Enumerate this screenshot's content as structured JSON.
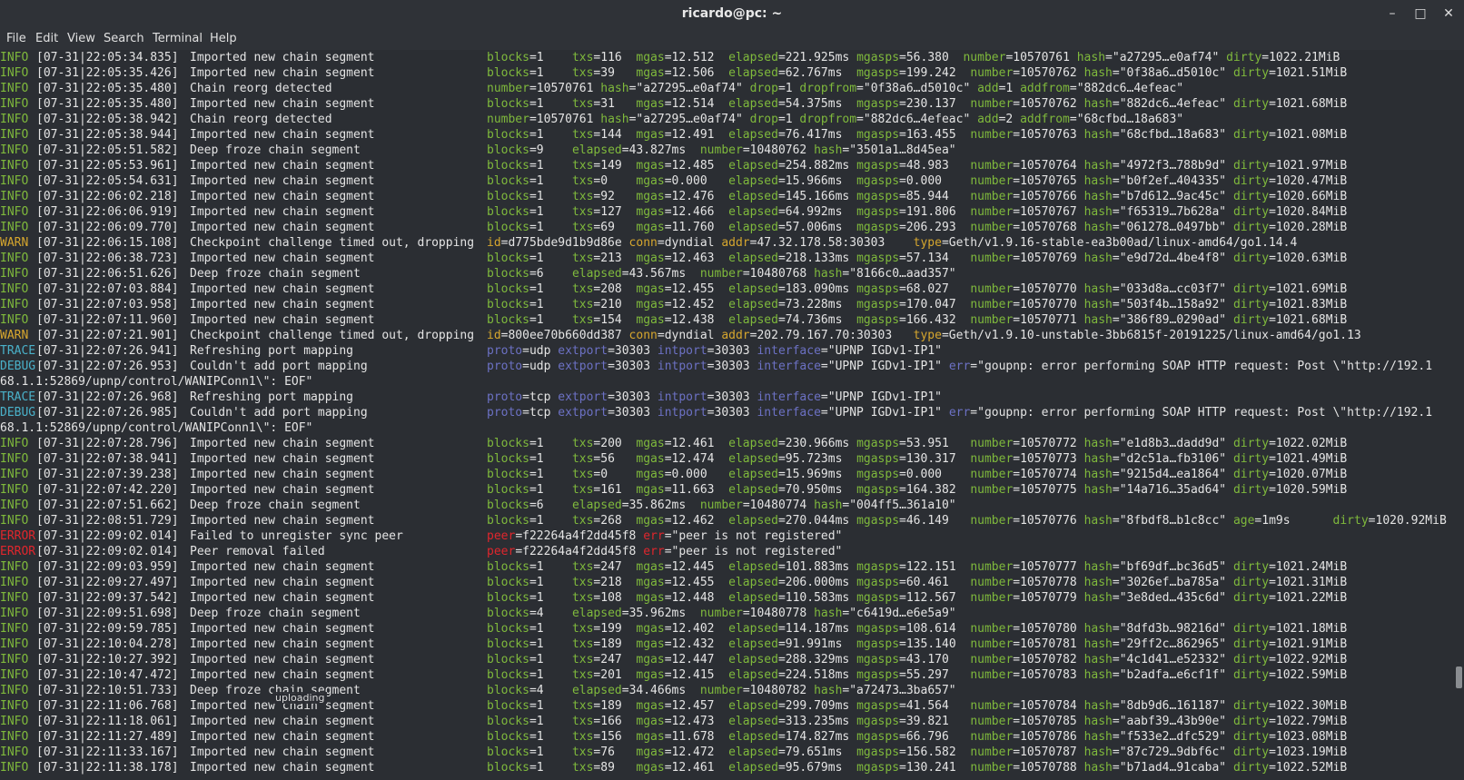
{
  "window": {
    "title": "ricardo@pc: ~"
  },
  "menu": [
    "File",
    "Edit",
    "View",
    "Search",
    "Terminal",
    "Help"
  ],
  "tooltip": "uploading",
  "scroll": {
    "position_fraction": 0.87
  },
  "colors": {
    "info": "#7fb93c",
    "warn": "#d6a62e",
    "error": "#e0262d",
    "trace_debug": "#4ab1c9",
    "key_trace_debug": "#6c71c4",
    "background": "#2b2e33"
  },
  "lines": [
    {
      "level": "INFO",
      "ts": "[07-31|22:05:34.835]",
      "msg": "Imported new chain segment",
      "fields": "blocks=1    txs=116  mgas=12.512  elapsed=221.925ms mgasps=56.380  number=10570761 hash=\"a27295…e0af74\" dirty=1022.21MiB"
    },
    {
      "level": "INFO",
      "ts": "[07-31|22:05:35.426]",
      "msg": "Imported new chain segment",
      "fields": "blocks=1    txs=39   mgas=12.506  elapsed=62.767ms  mgasps=199.242  number=10570762 hash=\"0f38a6…d5010c\" dirty=1021.51MiB"
    },
    {
      "level": "INFO",
      "ts": "[07-31|22:05:35.480]",
      "msg": "Chain reorg detected",
      "fields": "number=10570761 hash=\"a27295…e0af74\" drop=1 dropfrom=\"0f38a6…d5010c\" add=1 addfrom=\"882dc6…4efeac\""
    },
    {
      "level": "INFO",
      "ts": "[07-31|22:05:35.480]",
      "msg": "Imported new chain segment",
      "fields": "blocks=1    txs=31   mgas=12.514  elapsed=54.375ms  mgasps=230.137  number=10570762 hash=\"882dc6…4efeac\" dirty=1021.68MiB"
    },
    {
      "level": "INFO",
      "ts": "[07-31|22:05:38.942]",
      "msg": "Chain reorg detected",
      "fields": "number=10570761 hash=\"a27295…e0af74\" drop=1 dropfrom=\"882dc6…4efeac\" add=2 addfrom=\"68cfbd…18a683\""
    },
    {
      "level": "INFO",
      "ts": "[07-31|22:05:38.944]",
      "msg": "Imported new chain segment",
      "fields": "blocks=1    txs=144  mgas=12.491  elapsed=76.417ms  mgasps=163.455  number=10570763 hash=\"68cfbd…18a683\" dirty=1021.08MiB"
    },
    {
      "level": "INFO",
      "ts": "[07-31|22:05:51.582]",
      "msg": "Deep froze chain segment",
      "fields": "blocks=9    elapsed=43.827ms  number=10480762 hash=\"3501a1…8d45ea\""
    },
    {
      "level": "INFO",
      "ts": "[07-31|22:05:53.961]",
      "msg": "Imported new chain segment",
      "fields": "blocks=1    txs=149  mgas=12.485  elapsed=254.882ms mgasps=48.983   number=10570764 hash=\"4972f3…788b9d\" dirty=1021.97MiB"
    },
    {
      "level": "INFO",
      "ts": "[07-31|22:05:54.631]",
      "msg": "Imported new chain segment",
      "fields": "blocks=1    txs=0    mgas=0.000   elapsed=15.966ms  mgasps=0.000    number=10570765 hash=\"b0f2ef…404335\" dirty=1020.47MiB"
    },
    {
      "level": "INFO",
      "ts": "[07-31|22:06:02.218]",
      "msg": "Imported new chain segment",
      "fields": "blocks=1    txs=92   mgas=12.476  elapsed=145.166ms mgasps=85.944   number=10570766 hash=\"b7d612…9ac45c\" dirty=1020.66MiB"
    },
    {
      "level": "INFO",
      "ts": "[07-31|22:06:06.919]",
      "msg": "Imported new chain segment",
      "fields": "blocks=1    txs=127  mgas=12.466  elapsed=64.992ms  mgasps=191.806  number=10570767 hash=\"f65319…7b628a\" dirty=1020.84MiB"
    },
    {
      "level": "INFO",
      "ts": "[07-31|22:06:09.770]",
      "msg": "Imported new chain segment",
      "fields": "blocks=1    txs=69   mgas=11.760  elapsed=57.006ms  mgasps=206.293  number=10570768 hash=\"061278…0497bb\" dirty=1020.28MiB"
    },
    {
      "level": "WARN",
      "ts": "[07-31|22:06:15.108]",
      "msg": "Checkpoint challenge timed out, dropping",
      "fields": "id=d775bde9d1b9d86e conn=dyndial addr=47.32.178.58:30303    type=Geth/v1.9.16-stable-ea3b00ad/linux-amd64/go1.14.4"
    },
    {
      "level": "INFO",
      "ts": "[07-31|22:06:38.723]",
      "msg": "Imported new chain segment",
      "fields": "blocks=1    txs=213  mgas=12.463  elapsed=218.133ms mgasps=57.134   number=10570769 hash=\"e9d72d…4be4f8\" dirty=1020.63MiB"
    },
    {
      "level": "INFO",
      "ts": "[07-31|22:06:51.626]",
      "msg": "Deep froze chain segment",
      "fields": "blocks=6    elapsed=43.567ms  number=10480768 hash=\"8166c0…aad357\""
    },
    {
      "level": "INFO",
      "ts": "[07-31|22:07:03.884]",
      "msg": "Imported new chain segment",
      "fields": "blocks=1    txs=208  mgas=12.455  elapsed=183.090ms mgasps=68.027   number=10570770 hash=\"033d8a…cc03f7\" dirty=1021.69MiB"
    },
    {
      "level": "INFO",
      "ts": "[07-31|22:07:03.958]",
      "msg": "Imported new chain segment",
      "fields": "blocks=1    txs=210  mgas=12.452  elapsed=73.228ms  mgasps=170.047  number=10570770 hash=\"503f4b…158a92\" dirty=1021.83MiB"
    },
    {
      "level": "INFO",
      "ts": "[07-31|22:07:11.960]",
      "msg": "Imported new chain segment",
      "fields": "blocks=1    txs=154  mgas=12.438  elapsed=74.736ms  mgasps=166.432  number=10570771 hash=\"386f89…0290ad\" dirty=1021.68MiB"
    },
    {
      "level": "WARN",
      "ts": "[07-31|22:07:21.901]",
      "msg": "Checkpoint challenge timed out, dropping",
      "fields": "id=800ee70b660dd387 conn=dyndial addr=202.79.167.70:30303   type=Geth/v1.9.10-unstable-3bb6815f-20191225/linux-amd64/go1.13"
    },
    {
      "level": "TRACE",
      "ts": "[07-31|22:07:26.941]",
      "msg": "Refreshing port mapping",
      "fields": "proto=udp extport=30303 intport=30303 interface=\"UPNP IGDv1-IP1\""
    },
    {
      "level": "DEBUG",
      "ts": "[07-31|22:07:26.953]",
      "msg": "Couldn't add port mapping",
      "fields": "proto=udp extport=30303 intport=30303 interface=\"UPNP IGDv1-IP1\" err=\"goupnp: error performing SOAP HTTP request: Post \\\"http://192.1"
    },
    {
      "level": "",
      "ts": "",
      "msg": "",
      "fields": "",
      "wrap": "68.1.1:52869/upnp/control/WANIPConn1\\\": EOF\""
    },
    {
      "level": "TRACE",
      "ts": "[07-31|22:07:26.968]",
      "msg": "Refreshing port mapping",
      "fields": "proto=tcp extport=30303 intport=30303 interface=\"UPNP IGDv1-IP1\""
    },
    {
      "level": "DEBUG",
      "ts": "[07-31|22:07:26.985]",
      "msg": "Couldn't add port mapping",
      "fields": "proto=tcp extport=30303 intport=30303 interface=\"UPNP IGDv1-IP1\" err=\"goupnp: error performing SOAP HTTP request: Post \\\"http://192.1"
    },
    {
      "level": "",
      "ts": "",
      "msg": "",
      "fields": "",
      "wrap": "68.1.1:52869/upnp/control/WANIPConn1\\\": EOF\""
    },
    {
      "level": "INFO",
      "ts": "[07-31|22:07:28.796]",
      "msg": "Imported new chain segment",
      "fields": "blocks=1    txs=200  mgas=12.461  elapsed=230.966ms mgasps=53.951   number=10570772 hash=\"e1d8b3…dadd9d\" dirty=1022.02MiB"
    },
    {
      "level": "INFO",
      "ts": "[07-31|22:07:38.941]",
      "msg": "Imported new chain segment",
      "fields": "blocks=1    txs=56   mgas=12.474  elapsed=95.723ms  mgasps=130.317  number=10570773 hash=\"d2c51a…fb3106\" dirty=1021.49MiB"
    },
    {
      "level": "INFO",
      "ts": "[07-31|22:07:39.238]",
      "msg": "Imported new chain segment",
      "fields": "blocks=1    txs=0    mgas=0.000   elapsed=15.969ms  mgasps=0.000    number=10570774 hash=\"9215d4…ea1864\" dirty=1020.07MiB"
    },
    {
      "level": "INFO",
      "ts": "[07-31|22:07:42.220]",
      "msg": "Imported new chain segment",
      "fields": "blocks=1    txs=161  mgas=11.663  elapsed=70.950ms  mgasps=164.382  number=10570775 hash=\"14a716…35ad64\" dirty=1020.59MiB"
    },
    {
      "level": "INFO",
      "ts": "[07-31|22:07:51.662]",
      "msg": "Deep froze chain segment",
      "fields": "blocks=6    elapsed=35.862ms  number=10480774 hash=\"004ff5…361a10\""
    },
    {
      "level": "INFO",
      "ts": "[07-31|22:08:51.729]",
      "msg": "Imported new chain segment",
      "fields": "blocks=1    txs=268  mgas=12.462  elapsed=270.044ms mgasps=46.149   number=10570776 hash=\"8fbdf8…b1c8cc\" age=1m9s      dirty=1020.92MiB"
    },
    {
      "level": "ERROR",
      "ts": "[07-31|22:09:02.014]",
      "msg": "Failed to unregister sync peer",
      "fields": "peer=f22264a4f2dd45f8 err=\"peer is not registered\""
    },
    {
      "level": "ERROR",
      "ts": "[07-31|22:09:02.014]",
      "msg": "Peer removal failed",
      "fields": "peer=f22264a4f2dd45f8 err=\"peer is not registered\""
    },
    {
      "level": "INFO",
      "ts": "[07-31|22:09:03.959]",
      "msg": "Imported new chain segment",
      "fields": "blocks=1    txs=247  mgas=12.445  elapsed=101.883ms mgasps=122.151  number=10570777 hash=\"bf69df…bc36d5\" dirty=1021.24MiB"
    },
    {
      "level": "INFO",
      "ts": "[07-31|22:09:27.497]",
      "msg": "Imported new chain segment",
      "fields": "blocks=1    txs=218  mgas=12.455  elapsed=206.000ms mgasps=60.461   number=10570778 hash=\"3026ef…ba785a\" dirty=1021.31MiB"
    },
    {
      "level": "INFO",
      "ts": "[07-31|22:09:37.542]",
      "msg": "Imported new chain segment",
      "fields": "blocks=1    txs=108  mgas=12.448  elapsed=110.583ms mgasps=112.567  number=10570779 hash=\"3e8ded…435c6d\" dirty=1021.22MiB"
    },
    {
      "level": "INFO",
      "ts": "[07-31|22:09:51.698]",
      "msg": "Deep froze chain segment",
      "fields": "blocks=4    elapsed=35.962ms  number=10480778 hash=\"c6419d…e6e5a9\""
    },
    {
      "level": "INFO",
      "ts": "[07-31|22:09:59.785]",
      "msg": "Imported new chain segment",
      "fields": "blocks=1    txs=199  mgas=12.402  elapsed=114.187ms mgasps=108.614  number=10570780 hash=\"8dfd3b…98216d\" dirty=1021.18MiB"
    },
    {
      "level": "INFO",
      "ts": "[07-31|22:10:04.278]",
      "msg": "Imported new chain segment",
      "fields": "blocks=1    txs=189  mgas=12.432  elapsed=91.991ms  mgasps=135.140  number=10570781 hash=\"29ff2c…862965\" dirty=1021.91MiB"
    },
    {
      "level": "INFO",
      "ts": "[07-31|22:10:27.392]",
      "msg": "Imported new chain segment",
      "fields": "blocks=1    txs=247  mgas=12.447  elapsed=288.329ms mgasps=43.170   number=10570782 hash=\"4c1d41…e52332\" dirty=1022.92MiB"
    },
    {
      "level": "INFO",
      "ts": "[07-31|22:10:47.472]",
      "msg": "Imported new chain segment",
      "fields": "blocks=1    txs=201  mgas=12.415  elapsed=224.518ms mgasps=55.297   number=10570783 hash=\"b2adfa…e6cf1f\" dirty=1022.59MiB"
    },
    {
      "level": "INFO",
      "ts": "[07-31|22:10:51.733]",
      "msg": "Deep froze chain segment",
      "fields": "blocks=4    elapsed=34.466ms  number=10480782 hash=\"a72473…3ba657\""
    },
    {
      "level": "INFO",
      "ts": "[07-31|22:11:06.768]",
      "msg": "Imported new chain segment",
      "fields": "blocks=1    txs=189  mgas=12.457  elapsed=299.709ms mgasps=41.564   number=10570784 hash=\"8db9d6…161187\" dirty=1022.30MiB"
    },
    {
      "level": "INFO",
      "ts": "[07-31|22:11:18.061]",
      "msg": "Imported new chain segment",
      "fields": "blocks=1    txs=166  mgas=12.473  elapsed=313.235ms mgasps=39.821   number=10570785 hash=\"aabf39…43b90e\" dirty=1022.79MiB"
    },
    {
      "level": "INFO",
      "ts": "[07-31|22:11:27.489]",
      "msg": "Imported new chain segment",
      "fields": "blocks=1    txs=156  mgas=11.678  elapsed=174.827ms mgasps=66.796   number=10570786 hash=\"f533e2…dfc529\" dirty=1023.08MiB"
    },
    {
      "level": "INFO",
      "ts": "[07-31|22:11:33.167]",
      "msg": "Imported new chain segment",
      "fields": "blocks=1    txs=76   mgas=12.472  elapsed=79.651ms  mgasps=156.582  number=10570787 hash=\"87c729…9dbf6c\" dirty=1023.19MiB"
    },
    {
      "level": "INFO",
      "ts": "[07-31|22:11:38.178]",
      "msg": "Imported new chain segment",
      "fields": "blocks=1    txs=89   mgas=12.461  elapsed=95.679ms  mgasps=130.241  number=10570788 hash=\"b71ad4…91caba\" dirty=1022.52MiB"
    }
  ]
}
